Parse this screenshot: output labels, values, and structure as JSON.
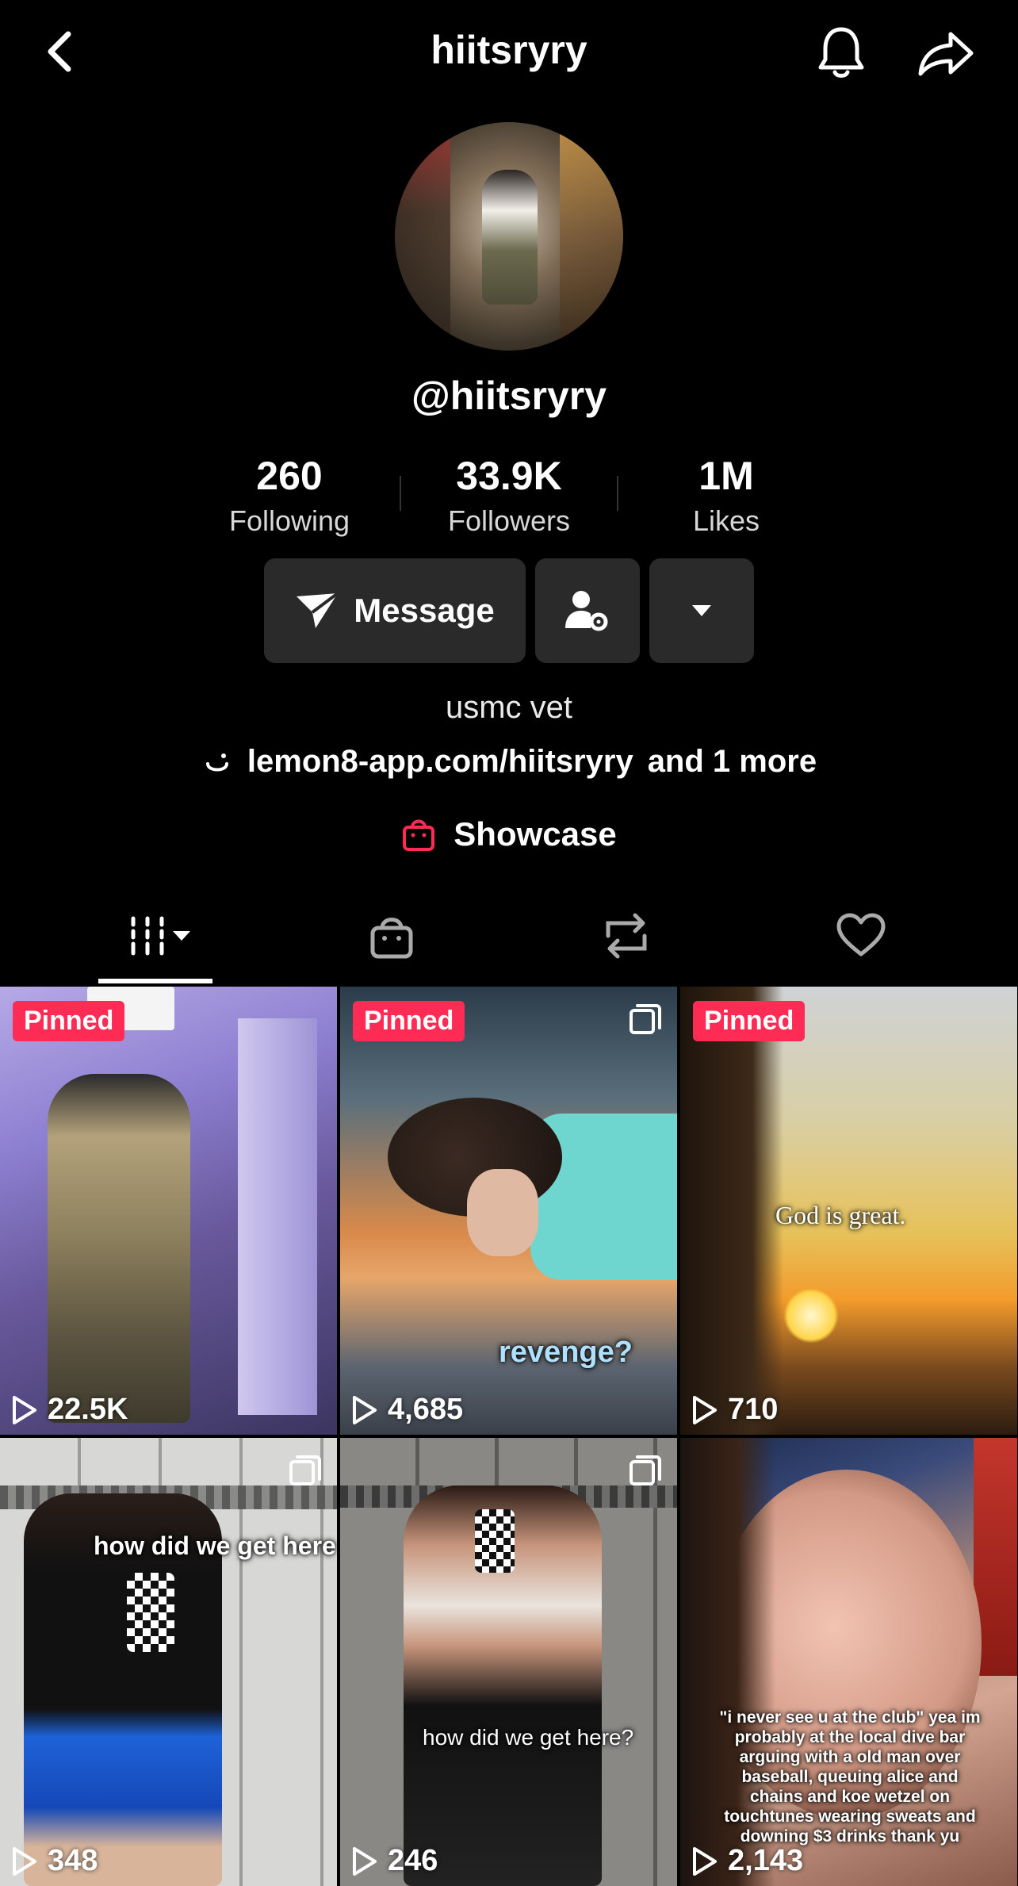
{
  "header": {
    "title": "hiitsryry"
  },
  "profile": {
    "handle": "@hiitsryry",
    "stats": [
      {
        "value": "260",
        "label": "Following"
      },
      {
        "value": "33.9K",
        "label": "Followers"
      },
      {
        "value": "1M",
        "label": "Likes"
      }
    ],
    "message_label": "Message",
    "bio": "usmc vet",
    "link_text": "lemon8-app.com/hiitsryry",
    "link_more": "and 1 more",
    "showcase_label": "Showcase"
  },
  "videos": [
    {
      "pinned": "Pinned",
      "views": "22.5K",
      "caption": "",
      "multi": false
    },
    {
      "pinned": "Pinned",
      "views": "4,685",
      "caption": "revenge?",
      "multi": true
    },
    {
      "pinned": "Pinned",
      "views": "710",
      "caption": "God is great.",
      "multi": false
    },
    {
      "pinned": "",
      "views": "348",
      "caption": "how did we get here",
      "multi": true
    },
    {
      "pinned": "",
      "views": "246",
      "caption": "how did we get here?",
      "multi": true
    },
    {
      "pinned": "",
      "views": "2,143",
      "caption": "\"i never see u at the club\" yea im probably at the local dive bar arguing with a old man over baseball, queuing alice and chains and koe wetzel on touchtunes wearing sweats and downing $3 drinks thank yu",
      "multi": false
    }
  ],
  "colors": {
    "accent": "#fe2c55",
    "button_bg": "#2a2a2a",
    "background": "#000000"
  }
}
